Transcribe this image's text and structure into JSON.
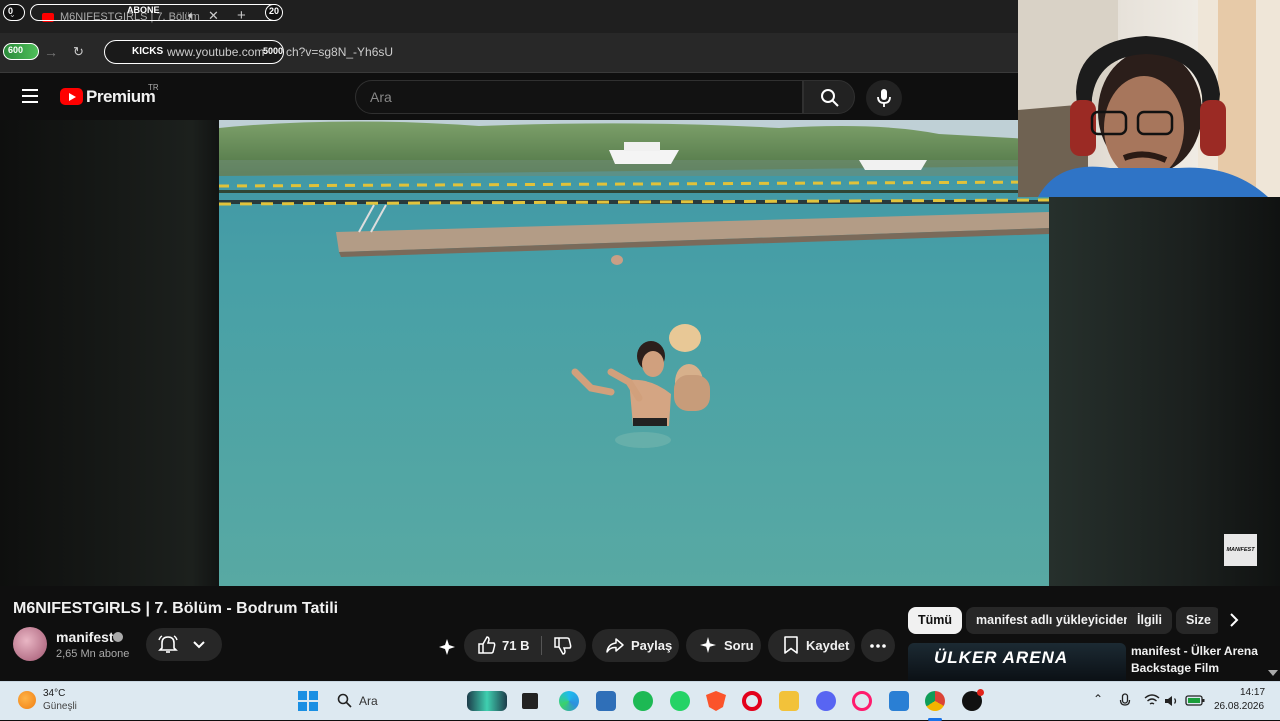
{
  "browser": {
    "overlay_left_count": "0",
    "overlay_abone": "ABONE",
    "overlay_right_count": "20",
    "tab_title": "M6NIFESTGIRLS | 7. Bölüm",
    "url": "https://www.youtube.com/watch?v=sg8N_-Yh6sU",
    "url_visible": "https://www.youtube.com/watch?v=sg8N_-Yh6sU",
    "url_prefix": "www.youtube.com",
    "url_suffix": "ch?v=sg8N_-Yh6sU",
    "overlay_600": "600",
    "overlay_kicks": "KICKS",
    "overlay_5000": "5000"
  },
  "youtube": {
    "logo_text": "Premium",
    "logo_region": "TR",
    "search_placeholder": "Ara"
  },
  "video": {
    "title": "M6NIFESTGIRLS | 7. Bölüm - Bodrum Tatili",
    "watermark": "MANIFEST"
  },
  "channel": {
    "name": "manifest",
    "subscribers": "2,65 Mn abone"
  },
  "actions": {
    "likes": "71 B",
    "share": "Paylaş",
    "ask": "Soru",
    "save": "Kaydet"
  },
  "chips": [
    "Tümü",
    "manifest adlı yükleyiciden",
    "İlgili",
    "Size"
  ],
  "recommendation": {
    "thumb_text": "ÜLKER ARENA",
    "title": "manifest - Ülker Arena Backstage Film"
  },
  "taskbar": {
    "weather_temp": "34°C",
    "weather_desc": "Güneşli",
    "search_label": "Ara",
    "time": "14:17",
    "date": "26.08.2026"
  },
  "colors": {
    "yt_red": "#ff0000",
    "background": "#0f0f0f",
    "button_bg": "#272727",
    "taskbar_bg": "#dde9f1"
  }
}
